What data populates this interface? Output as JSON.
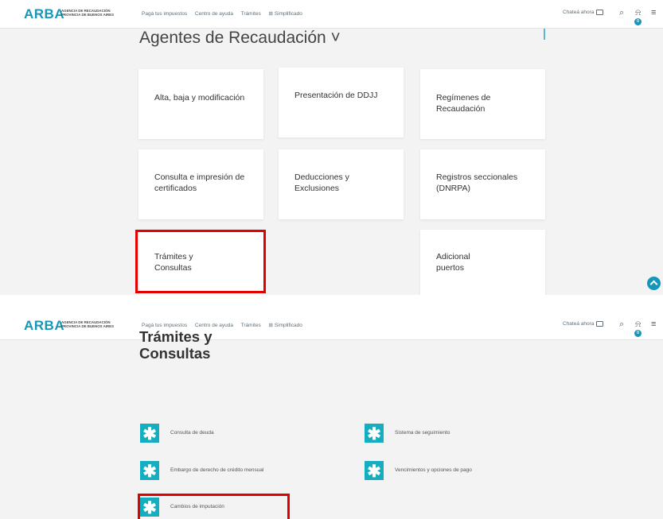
{
  "header": {
    "logo": "ARBA",
    "agency_line1": "AGENCIA DE RECAUDACIÓN",
    "agency_line2": "PROVINCIA DE BUENOS AIRES",
    "nav": [
      "Pagá tus impuestos",
      "Centro de ayuda",
      "Trámites",
      "⊞ Simplificado"
    ],
    "chat": "Chateá ahora",
    "notification_count": "0",
    "icons": [
      "search-icon",
      "bell-icon",
      "menu-icon"
    ]
  },
  "shot1": {
    "title": "Agentes de Recaudación ˅",
    "cards": [
      "Alta, baja y modificación",
      "Presentación de DDJJ",
      "Regímenes de Recaudación",
      "Consulta e impresión de certificados",
      "Deducciones y Exclusiones",
      "Registros seccionales (DNRPA)",
      "Trámites y Consultas",
      "Adicional puertos"
    ]
  },
  "shot2": {
    "title_line1": "Trámites y",
    "title_line2": "Consultas",
    "items": [
      "Consulta de deuda",
      "Sistema de seguimiento",
      "Embargo de derecho de crédito mensual",
      "Vencimientos y opciones de pago",
      "Cambios de imputación"
    ],
    "item_icon": "✱"
  },
  "colors": {
    "brand": "#1796b7",
    "item_badge": "#14aec0",
    "highlight": "#e50000"
  }
}
